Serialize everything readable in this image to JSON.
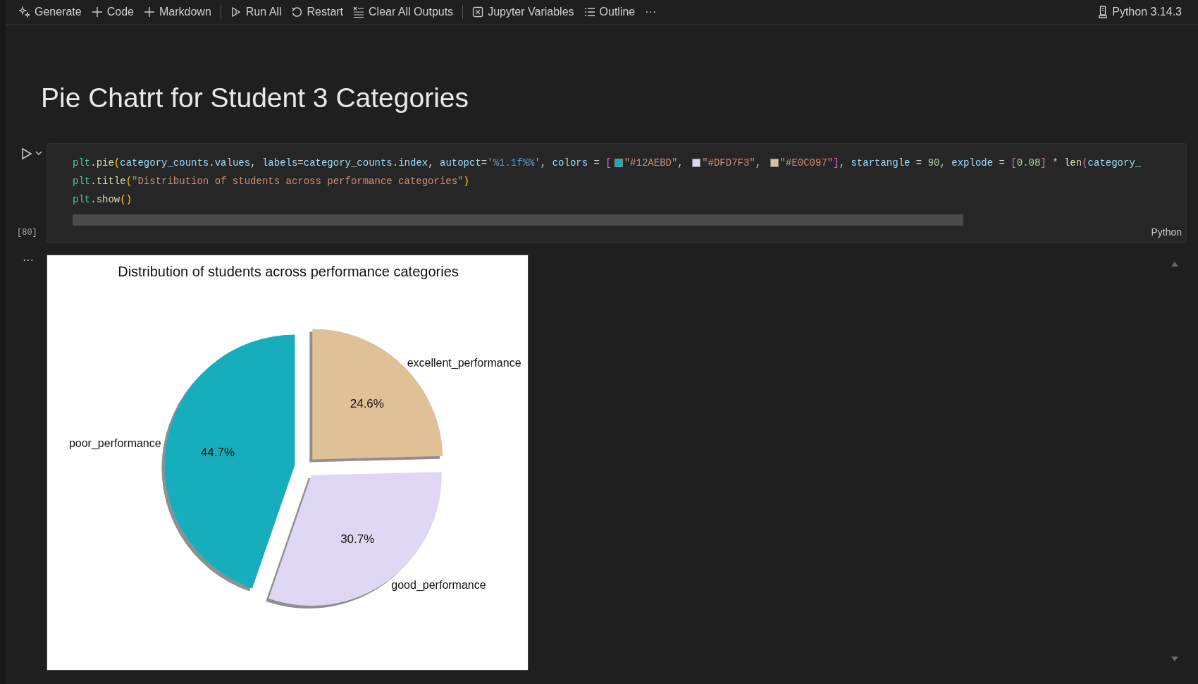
{
  "toolbar": {
    "groups": [
      [
        {
          "kind": "generate",
          "label": "Generate"
        },
        {
          "kind": "add",
          "label": "Code"
        },
        {
          "kind": "add",
          "label": "Markdown"
        }
      ],
      [
        {
          "kind": "run",
          "label": "Run All"
        },
        {
          "kind": "restart",
          "label": "Restart"
        },
        {
          "kind": "clear",
          "label": "Clear All Outputs"
        }
      ],
      [
        {
          "kind": "variables",
          "label": "Jupyter Variables"
        },
        {
          "kind": "outline",
          "label": "Outline"
        },
        {
          "kind": "more",
          "label": "···"
        }
      ]
    ],
    "kernel": {
      "label": "Python 3.14.3"
    }
  },
  "heading": "Pie Chatrt for Student 3 Categories",
  "cell": {
    "execution_count": "[80]",
    "language": "Python",
    "lines": [
      [
        {
          "kind": "code",
          "tokens": [
            {
              "text": "plt",
              "kind": "cls"
            },
            {
              "text": ".",
              "kind": "p"
            },
            {
              "text": "pie",
              "kind": "fn"
            },
            {
              "text": "(",
              "kind": "b1"
            },
            {
              "text": "category_counts",
              "kind": "var"
            },
            {
              "text": ".",
              "kind": "p"
            },
            {
              "text": "values",
              "kind": "var"
            },
            {
              "text": ", ",
              "kind": "p"
            },
            {
              "text": "labels",
              "kind": "var"
            },
            {
              "text": "=",
              "kind": "p"
            },
            {
              "text": "category_counts",
              "kind": "var"
            },
            {
              "text": ".",
              "kind": "p"
            },
            {
              "text": "index",
              "kind": "var"
            },
            {
              "text": ", ",
              "kind": "p"
            },
            {
              "text": "autopct",
              "kind": "var"
            },
            {
              "text": "=",
              "kind": "p"
            },
            {
              "text": "'",
              "kind": "str"
            },
            {
              "text": "%1.1f%%",
              "kind": "fmt"
            },
            {
              "text": "'",
              "kind": "str"
            },
            {
              "text": ", ",
              "kind": "p"
            },
            {
              "text": "colors",
              "kind": "var"
            },
            {
              "text": " = ",
              "kind": "p"
            },
            {
              "text": "[",
              "kind": "b2"
            }
          ]
        },
        {
          "kind": "swatch",
          "color": "#12aebd"
        },
        {
          "kind": "code",
          "tokens": [
            {
              "text": "\"#12AEBD\"",
              "kind": "str"
            },
            {
              "text": ", ",
              "kind": "p"
            }
          ]
        },
        {
          "kind": "swatch",
          "color": "#dfd7f3"
        },
        {
          "kind": "code",
          "tokens": [
            {
              "text": "\"#DFD7F3\"",
              "kind": "str"
            },
            {
              "text": ", ",
              "kind": "p"
            }
          ]
        },
        {
          "kind": "swatch",
          "color": "#e0c097"
        },
        {
          "kind": "code",
          "tokens": [
            {
              "text": "\"#E0C097\"",
              "kind": "str"
            },
            {
              "text": "]",
              "kind": "b2"
            },
            {
              "text": ", ",
              "kind": "p"
            },
            {
              "text": "startangle",
              "kind": "var"
            },
            {
              "text": " = ",
              "kind": "p"
            },
            {
              "text": "90",
              "kind": "num"
            },
            {
              "text": ", ",
              "kind": "p"
            },
            {
              "text": "explode",
              "kind": "var"
            },
            {
              "text": " = ",
              "kind": "p"
            },
            {
              "text": "[",
              "kind": "b2"
            },
            {
              "text": "0.08",
              "kind": "num"
            },
            {
              "text": "]",
              "kind": "b2"
            },
            {
              "text": " * ",
              "kind": "p"
            },
            {
              "text": "len",
              "kind": "fn"
            },
            {
              "text": "(",
              "kind": "b2"
            },
            {
              "text": "category_",
              "kind": "var"
            }
          ]
        }
      ],
      [
        {
          "kind": "code",
          "tokens": [
            {
              "text": "plt",
              "kind": "cls"
            },
            {
              "text": ".",
              "kind": "p"
            },
            {
              "text": "title",
              "kind": "fn"
            },
            {
              "text": "(",
              "kind": "b1"
            },
            {
              "text": "\"Distribution of students across performance categories\"",
              "kind": "str"
            },
            {
              "text": ")",
              "kind": "b1"
            }
          ]
        }
      ],
      [
        {
          "kind": "code",
          "tokens": [
            {
              "text": "plt",
              "kind": "cls"
            },
            {
              "text": ".",
              "kind": "p"
            },
            {
              "text": "show",
              "kind": "fn"
            },
            {
              "text": "()",
              "kind": "b1"
            }
          ]
        }
      ]
    ]
  },
  "output": {
    "menu": "···",
    "chart_data": {
      "type": "pie",
      "title": "Distribution of students across performance categories",
      "categories": [
        "poor_performance",
        "good_performance",
        "excellent_performance"
      ],
      "values": [
        44.7,
        30.7,
        24.6
      ],
      "colors": [
        "#12aebd",
        "#dfd7f3",
        "#e0c097"
      ],
      "value_labels": [
        "44.7%",
        "30.7%",
        "24.6%"
      ]
    }
  }
}
